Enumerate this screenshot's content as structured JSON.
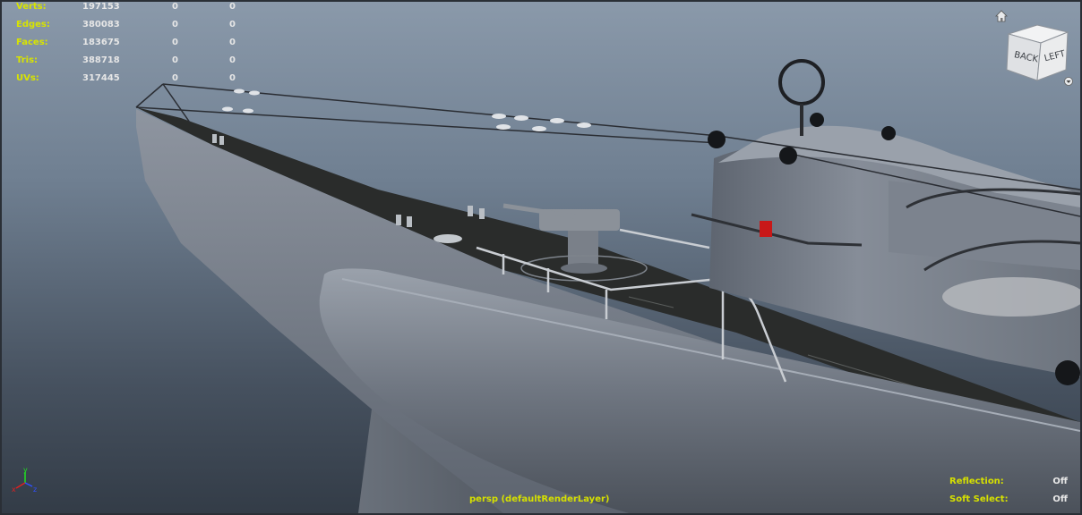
{
  "hud": {
    "stats": [
      {
        "label": "Verts:",
        "v1": "197153",
        "v2": "0",
        "v3": "0"
      },
      {
        "label": "Edges:",
        "v1": "380083",
        "v2": "0",
        "v3": "0"
      },
      {
        "label": "Faces:",
        "v1": "183675",
        "v2": "0",
        "v3": "0"
      },
      {
        "label": "Tris:",
        "v1": "388718",
        "v2": "0",
        "v3": "0"
      },
      {
        "label": "UVs:",
        "v1": "317445",
        "v2": "0",
        "v3": "0"
      }
    ],
    "camera": "persp (defaultRenderLayer)",
    "reflection_label": "Reflection:",
    "reflection_value": "Off",
    "soft_select_label": "Soft Select:",
    "soft_select_value": "Off"
  },
  "viewcube": {
    "face_back": "BACK",
    "face_left": "LEFT"
  },
  "axis": {
    "x": "x",
    "y": "y",
    "z": "z"
  },
  "colors": {
    "hud_label": "#d8e400",
    "hud_value": "#e6e6e6",
    "axis_x": "#e02020",
    "axis_y": "#20e020",
    "axis_z": "#3050ff"
  }
}
